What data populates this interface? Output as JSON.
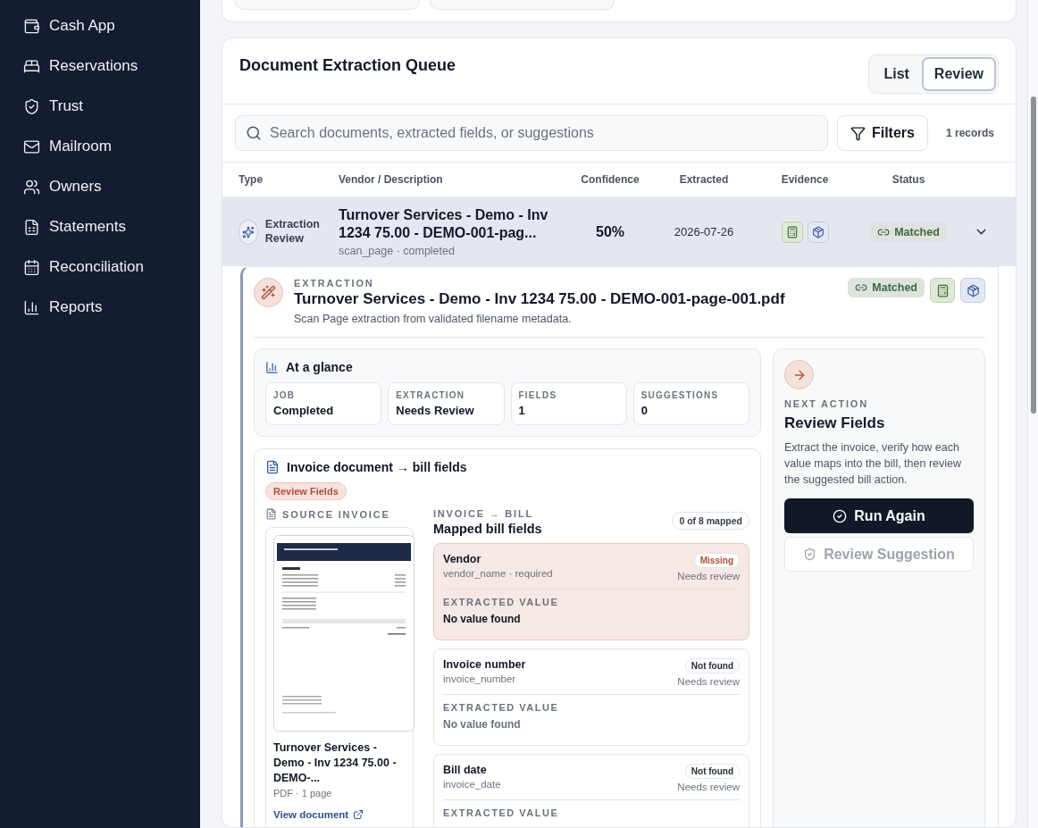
{
  "sidebar": {
    "items": [
      {
        "label": "Cash App"
      },
      {
        "label": "Reservations"
      },
      {
        "label": "Trust"
      },
      {
        "label": "Mailroom"
      },
      {
        "label": "Owners"
      },
      {
        "label": "Statements"
      },
      {
        "label": "Reconciliation"
      },
      {
        "label": "Reports"
      }
    ]
  },
  "queue": {
    "title": "Document Extraction Queue",
    "view_toggle": [
      {
        "label": "List",
        "selected": false
      },
      {
        "label": "Review",
        "selected": true
      }
    ],
    "search": {
      "placeholder": "Search documents, extracted fields, or suggestions"
    },
    "filters_button": "Filters",
    "record_count": "1 records",
    "columns": [
      "Type",
      "Vendor / Description",
      "Confidence",
      "Extracted",
      "Evidence",
      "Status"
    ],
    "rows": [
      {
        "type": "Extraction Review",
        "vendor": "Turnover Services - Demo - Inv 1234 75.00 - DEMO-001-pag...",
        "meta": "scan_page · completed",
        "confidence": "50%",
        "extracted": "2026-07-26",
        "status": "Matched",
        "selected": true,
        "expanded": true
      }
    ]
  },
  "detail": {
    "eyebrow": "EXTRACTION",
    "title": "Turnover Services - Demo - Inv 1234 75.00 - DEMO-001-page-001.pdf",
    "subtitle": "Scan Page extraction from validated filename metadata.",
    "status": "Matched",
    "glance": {
      "title": "At a glance",
      "stats": [
        {
          "label": "JOB",
          "value": "Completed"
        },
        {
          "label": "EXTRACTION",
          "value": "Needs Review"
        },
        {
          "label": "FIELDS",
          "value": "1"
        },
        {
          "label": "SUGGESTIONS",
          "value": "0"
        }
      ]
    },
    "mapping": {
      "title": "Invoice document → bill fields",
      "badge": "Review Fields",
      "source_label": "SOURCE INVOICE",
      "doc_title": "Turnover Services - Demo - Inv 1234 75.00 - DEMO-...",
      "doc_meta": "PDF · 1 page",
      "view_link": "View document",
      "eyebrow": "INVOICE → BILL",
      "heading": "Mapped bill fields",
      "count": "0 of 8 mapped",
      "fields": [
        {
          "kind": "missing",
          "name": "Vendor",
          "key": "vendor_name · required",
          "badge": "Missing",
          "review": "Needs review",
          "value_label": "EXTRACTED VALUE",
          "value": "No value found"
        },
        {
          "kind": "not_found",
          "name": "Invoice number",
          "key": "invoice_number",
          "badge": "Not found",
          "review": "Needs review",
          "value_label": "EXTRACTED VALUE",
          "value": "No value found"
        },
        {
          "kind": "not_found",
          "name": "Bill date",
          "key": "invoice_date",
          "badge": "Not found",
          "review": "Needs review",
          "value_label": "EXTRACTED VALUE"
        }
      ]
    },
    "next_action": {
      "eyebrow": "NEXT ACTION",
      "title": "Review Fields",
      "description": "Extract the invoice, verify how each value maps into the bill, then review the suggested bill action.",
      "primary": "Run Again",
      "secondary": "Review Suggestion",
      "secondary_disabled": true
    }
  }
}
